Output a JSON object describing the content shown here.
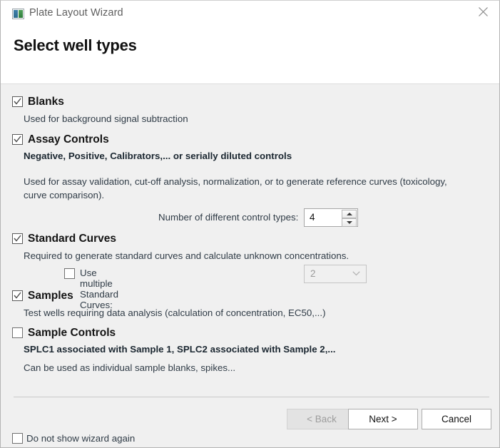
{
  "window": {
    "title": "Plate Layout Wizard",
    "icon": "plate-app-icon",
    "close_icon": "close-icon"
  },
  "header": {
    "page_title": "Select well types"
  },
  "colors": {
    "header_bg": "#ffffff",
    "body_bg": "#f0f0f0",
    "title_text": "#5e5e5e",
    "heading_text": "#111111",
    "desc_text": "#2f3b46",
    "disabled_text": "#9d9d9d",
    "border": "#adadad"
  },
  "groups": [
    {
      "id": "blanks",
      "label": "Blanks",
      "checked": true,
      "description": "Used for background signal subtraction"
    },
    {
      "id": "assay-controls",
      "label": "Assay Controls",
      "checked": true,
      "subtitle": "Negative, Positive, Calibrators,... or serially diluted controls",
      "description": "Used for assay validation, cut-off analysis, normalization, or to generate reference curves (toxicology, curve comparison)."
    },
    {
      "id": "standard-curves",
      "label": "Standard Curves",
      "checked": true,
      "description": "Required to generate standard curves and calculate unknown concentrations."
    },
    {
      "id": "samples",
      "label": "Samples",
      "checked": true,
      "description": "Test wells requiring data analysis (calculation of concentration, EC50,...)"
    },
    {
      "id": "sample-controls",
      "label": "Sample Controls",
      "checked": false,
      "subtitle": "SPLC1 associated with Sample 1, SPLC2 associated with Sample 2,...",
      "description": "Can be used as individual sample blanks, spikes..."
    }
  ],
  "control_types": {
    "label": "Number of different control types:",
    "value": "4",
    "up_icon": "chevron-up-icon",
    "down_icon": "chevron-down-icon"
  },
  "multiple_standard_curves": {
    "label": "Use multiple Standard Curves:",
    "checked": false,
    "select_value": "2",
    "select_enabled": false,
    "select_arrow_icon": "chevron-down-icon"
  },
  "footer": {
    "back_label": "< Back",
    "back_enabled": false,
    "next_label": "Next >",
    "next_enabled": true,
    "cancel_label": "Cancel",
    "cancel_enabled": true,
    "do_not_show_label": "Do not show wizard again",
    "do_not_show_checked": false
  }
}
